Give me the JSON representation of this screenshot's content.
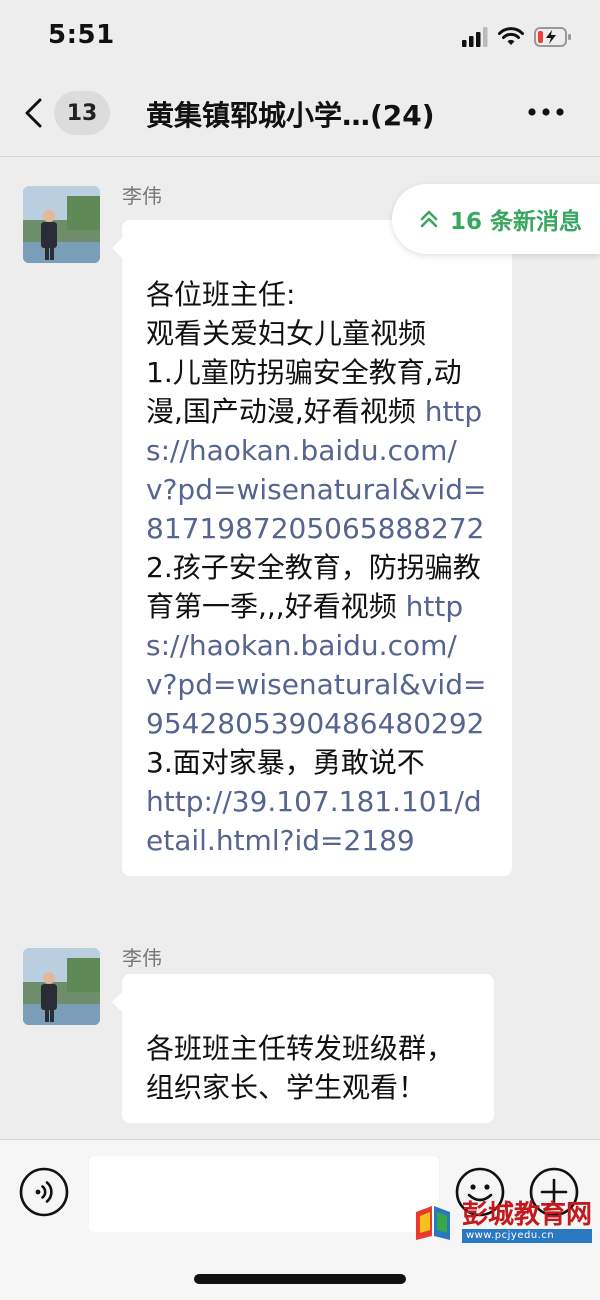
{
  "status_bar": {
    "time": "5:51"
  },
  "nav": {
    "unread_count": "13",
    "title": "黄集镇郓城小学…(24)"
  },
  "new_messages_banner": "16 条新消息",
  "messages": [
    {
      "sender": "李伟",
      "segments": [
        {
          "text": "各位班主任:\n观看关爱妇女儿童视频\n1.儿童防拐骗安全教育,动漫,国产动漫,好看视频 ",
          "link": false
        },
        {
          "text": "https://haokan.baidu.com/v?pd=wisenatural&vid=8171987205065888272",
          "link": true
        },
        {
          "text": "\n2.孩子安全教育，防拐骗教育第一季,,,好看视频 ",
          "link": false
        },
        {
          "text": "https://haokan.baidu.com/v?pd=wisenatural&vid=9542805390486480292",
          "link": true
        },
        {
          "text": "\n3.面对家暴，勇敢说不\n",
          "link": false
        },
        {
          "text": "http://39.107.181.101/detail.html?id=2189",
          "link": true
        }
      ]
    },
    {
      "sender": "李伟",
      "segments": [
        {
          "text": "各班班主任转发班级群，组织家长、学生观看！",
          "link": false
        }
      ]
    }
  ],
  "input": {
    "placeholder": ""
  },
  "watermark": {
    "name": "彭城教育网",
    "url": "www.pcjyedu.cn"
  },
  "colors": {
    "link": "#55658f",
    "accent_green": "#39a660",
    "background": "#ededed"
  }
}
